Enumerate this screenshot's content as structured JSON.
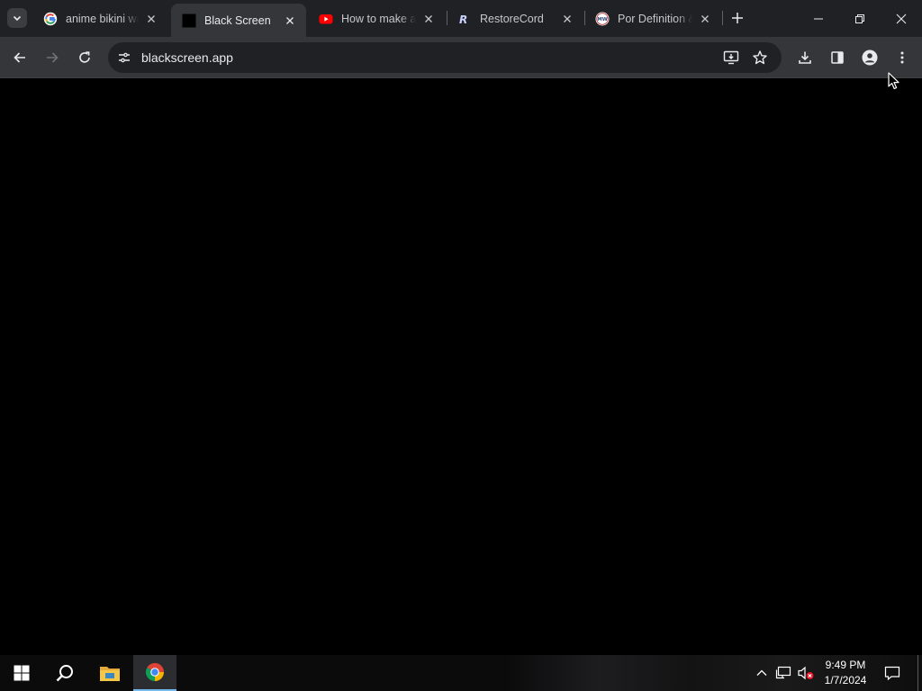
{
  "browser": {
    "tabs": [
      {
        "title": "anime bikini wa",
        "favicon": "google-icon",
        "active": false
      },
      {
        "title": "Black Screen",
        "favicon": "black-square-icon",
        "active": true
      },
      {
        "title": "How to make a",
        "favicon": "youtube-icon",
        "active": false
      },
      {
        "title": "RestoreCord",
        "favicon": "restorecord-icon",
        "active": false
      },
      {
        "title": "Por Definition &",
        "favicon": "merriam-webster-icon",
        "active": false
      }
    ],
    "mw_badge": "MW",
    "restorecord_glyph": "R",
    "url": "blackscreen.app"
  },
  "taskbar": {
    "time": "9:49 PM",
    "date": "1/7/2024"
  },
  "colors": {
    "tabstrip": "#202124",
    "toolbar": "#35363a",
    "omnibox": "#202124",
    "content": "#000000",
    "taskbar_active_underline": "#76b9ed"
  }
}
